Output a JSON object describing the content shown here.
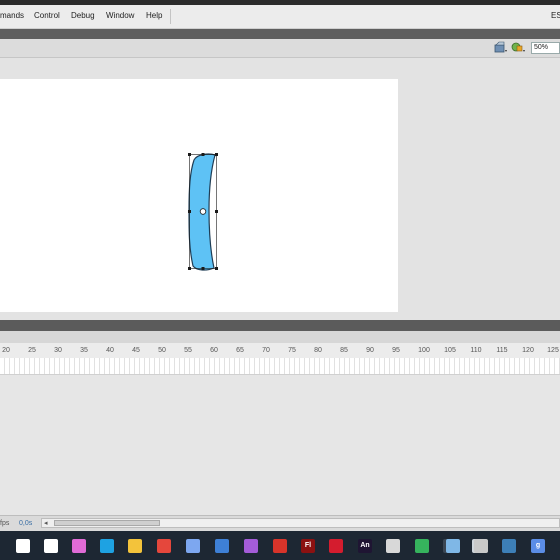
{
  "menu": {
    "items": [
      "mands",
      "Control",
      "Debug",
      "Window",
      "Help"
    ],
    "workspace": "ES"
  },
  "toolbar": {
    "zoom": "50%"
  },
  "timeline": {
    "ruler": [
      "20",
      "25",
      "30",
      "35",
      "40",
      "45",
      "50",
      "55",
      "60",
      "65",
      "70",
      "75",
      "80",
      "85",
      "90",
      "95",
      "100",
      "105",
      "110",
      "115",
      "120",
      "125"
    ]
  },
  "status": {
    "fps": "fps",
    "time": "0,0s"
  },
  "taskbar": {
    "apps": [
      {
        "name": "windows-icon",
        "label": "",
        "color": "#ffffff"
      },
      {
        "name": "task-view-icon",
        "label": "",
        "color": "#ffffff"
      },
      {
        "name": "copilot-icon",
        "label": "",
        "color": "#e06bd6"
      },
      {
        "name": "edge-icon",
        "label": "",
        "color": "#1ea2e2"
      },
      {
        "name": "file-explorer-icon",
        "label": "",
        "color": "#f3c33b"
      },
      {
        "name": "chrome-icon",
        "label": "",
        "color": "#e5473c"
      },
      {
        "name": "chrome-alt-icon",
        "label": "",
        "color": "#7da7f0"
      },
      {
        "name": "store-icon",
        "label": "",
        "color": "#3e80d6"
      },
      {
        "name": "media-icon",
        "label": "",
        "color": "#a45cd8"
      },
      {
        "name": "flash-icon",
        "label": "",
        "color": "#d8342a"
      },
      {
        "name": "flash-pro-icon",
        "label": "Fl",
        "color": "#8b1111"
      },
      {
        "name": "flash-red-icon",
        "label": "",
        "color": "#d41c2e"
      },
      {
        "name": "animate-icon",
        "label": "An",
        "color": "#1f1533"
      },
      {
        "name": "inkscape-icon",
        "label": "",
        "color": "#d8d8d8"
      },
      {
        "name": "vectr-icon",
        "label": "",
        "color": "#36b35d"
      },
      {
        "name": "sketch-icon",
        "label": "",
        "color": "#3b4653"
      },
      {
        "name": "browser-icon",
        "label": "",
        "color": "#cfd6dc"
      },
      {
        "name": "image-viewer-icon",
        "label": "",
        "color": "#7fb7e6"
      },
      {
        "name": "toggle-icon",
        "label": "",
        "color": "#c9c9c9"
      },
      {
        "name": "steam-icon",
        "label": "",
        "color": "#3d7fb7"
      },
      {
        "name": "g-app-icon",
        "label": "g",
        "color": "#5b8de6"
      }
    ]
  }
}
